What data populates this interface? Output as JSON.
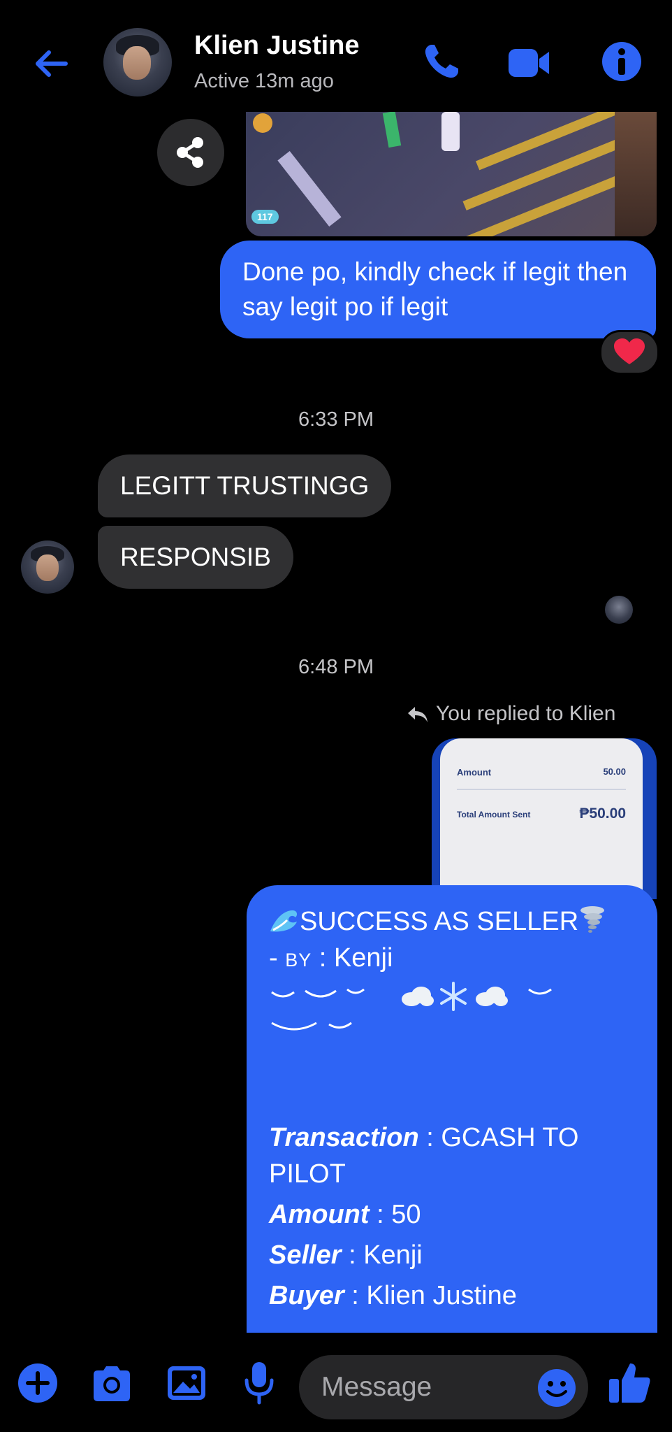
{
  "header": {
    "name": "Klien Justine",
    "status": "Active 13m ago"
  },
  "thread": {
    "shared_image_badge": "117",
    "message_out_1": "Done po, kindly check if legit then say legit po if legit",
    "reaction_1": "heart",
    "time_1": "6:33 PM",
    "incoming": [
      "LEGITT TRUSTINGG",
      "RESPONSIB"
    ],
    "time_2": "6:48 PM",
    "reply_note": "You replied to Klien",
    "receipt": {
      "amount_label": "Amount",
      "amount_value": "50.00",
      "total_label": "Total Amount Sent",
      "total_value": "₱50.00"
    },
    "success": {
      "title": "SUCCESS AS SELLER",
      "by_prefix": "- ",
      "by_label": "BY",
      "by_value": " : Kenji",
      "transaction_label": "Transaction",
      "transaction_value": " : GCASH TO PILOT",
      "amount_label": "Amount",
      "amount_value": " : 50",
      "seller_label": "Seller",
      "seller_value": " : Kenji",
      "buyer_label": "Buyer",
      "buyer_value": " : Klien Justine"
    }
  },
  "composer": {
    "placeholder": "Message"
  },
  "colors": {
    "accent": "#2e64f5",
    "bubble_in": "#303032",
    "background": "#000000"
  }
}
